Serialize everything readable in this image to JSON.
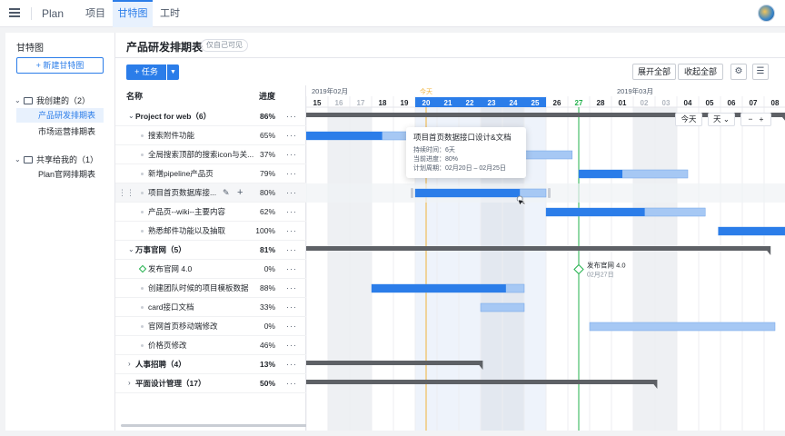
{
  "topbar": {
    "brand": "Plan",
    "tabs": [
      {
        "label": "项目",
        "active": false
      },
      {
        "label": "甘特图",
        "active": true
      },
      {
        "label": "工时",
        "active": false
      }
    ]
  },
  "sidebar": {
    "title": "甘特图",
    "new_button": "新建甘特图",
    "groups": [
      {
        "label": "我创建的（2）",
        "items": [
          {
            "label": "产品研发排期表",
            "active": true
          },
          {
            "label": "市场运营排期表",
            "active": false
          }
        ]
      },
      {
        "label": "共享给我的（1）",
        "items": [
          {
            "label": "Plan官网排期表",
            "active": false
          }
        ]
      }
    ]
  },
  "main": {
    "title": "产品研发排期表",
    "visibility": "仅自己可见",
    "task_button": "任务",
    "expand_all": "展开全部",
    "collapse_all": "收起全部",
    "col_name": "名称",
    "col_progress": "进度",
    "more": "···"
  },
  "rows": [
    {
      "name": "Project for web（6）",
      "progress": "86%",
      "type": "group",
      "expanded": true
    },
    {
      "name": "搜索附件功能",
      "progress": "65%",
      "type": "task"
    },
    {
      "name": "全局搜索顶部的搜索icon与关...",
      "progress": "37%",
      "type": "task"
    },
    {
      "name": "新增pipeline产品页",
      "progress": "79%",
      "type": "task"
    },
    {
      "name": "项目首页数据库接...",
      "progress": "80%",
      "type": "task",
      "highlight": true
    },
    {
      "name": "产品页--wiki--主要内容",
      "progress": "62%",
      "type": "task"
    },
    {
      "name": "熟悉邮件功能以及抽取",
      "progress": "100%",
      "type": "task"
    },
    {
      "name": "万事官网（5）",
      "progress": "81%",
      "type": "group",
      "expanded": true
    },
    {
      "name": "发布官网 4.0",
      "progress": "0%",
      "type": "milestone"
    },
    {
      "name": "创建团队时候的项目模板数据",
      "progress": "88%",
      "type": "task"
    },
    {
      "name": "card接口文档",
      "progress": "33%",
      "type": "task"
    },
    {
      "name": "官网首页移动端修改",
      "progress": "0%",
      "type": "task"
    },
    {
      "name": "价格页修改",
      "progress": "46%",
      "type": "task"
    },
    {
      "name": "人事招聘（4）",
      "progress": "13%",
      "type": "group",
      "expanded": false
    },
    {
      "name": "平面设计管理（17）",
      "progress": "50%",
      "type": "group",
      "expanded": false
    }
  ],
  "timeline": {
    "month_labels": [
      {
        "label": "2019年02月",
        "start_index": 0
      },
      {
        "label": "2019年03月",
        "start_index": 14
      }
    ],
    "days": [
      "15",
      "16",
      "17",
      "18",
      "19",
      "20",
      "21",
      "22",
      "23",
      "24",
      "25",
      "26",
      "27",
      "28",
      "01",
      "02",
      "03",
      "04",
      "05",
      "06",
      "07",
      "08"
    ],
    "weekend": [
      false,
      true,
      true,
      false,
      false,
      false,
      false,
      false,
      true,
      true,
      false,
      false,
      false,
      false,
      false,
      true,
      true,
      false,
      false,
      false,
      false,
      false
    ],
    "selected_range": [
      5,
      10
    ],
    "today_index": 5,
    "today_label": "今天",
    "zoom_today": "今天",
    "zoom_unit": "天",
    "zoom_minus": "−",
    "zoom_plus": "+"
  },
  "chart_data": {
    "type": "gantt",
    "day_units": "day index from 2019-02-15",
    "summaries": [
      {
        "row": 0,
        "start": 0,
        "end": 22
      },
      {
        "row": 7,
        "start": 0,
        "end": 21.3
      },
      {
        "row": 13,
        "start": 0,
        "end": 8.1
      },
      {
        "row": 14,
        "start": 0,
        "end": 16.1
      }
    ],
    "bars": [
      {
        "row": 1,
        "start": -1,
        "end": 5.9,
        "progress": 0.65
      },
      {
        "row": 2,
        "start": 5,
        "end": 12.2,
        "progress": 0.37
      },
      {
        "row": 3,
        "start": 12.5,
        "end": 17.5,
        "progress": 0.4
      },
      {
        "row": 4,
        "start": 5,
        "end": 11,
        "progress": 0.8
      },
      {
        "row": 5,
        "start": 11,
        "end": 18.3,
        "progress": 0.62
      },
      {
        "row": 6,
        "start": 18.9,
        "end": 23,
        "progress": 1.0
      },
      {
        "row": 9,
        "start": 3,
        "end": 10,
        "progress": 0.88
      },
      {
        "row": 10,
        "start": 8,
        "end": 10,
        "progress": 0.0
      },
      {
        "row": 11,
        "start": 13,
        "end": 21.5,
        "progress": 0.0
      }
    ],
    "milestones": [
      {
        "row": 8,
        "at": 12.5,
        "title": "发布官网 4.0",
        "date": "02月27日"
      }
    ],
    "tooltip": {
      "title": "项目首页数据接口设计&文档",
      "duration": "持续时间：6天",
      "progress": "当前进度：80%",
      "period": "计划周期：02月20日 – 02月25日"
    }
  },
  "colors": {
    "accent": "#2b7de9",
    "bar_light": "#a6c8f4",
    "summary": "#5e6166",
    "today_line": "#f0b33a",
    "milestone_line": "#23b14d"
  }
}
